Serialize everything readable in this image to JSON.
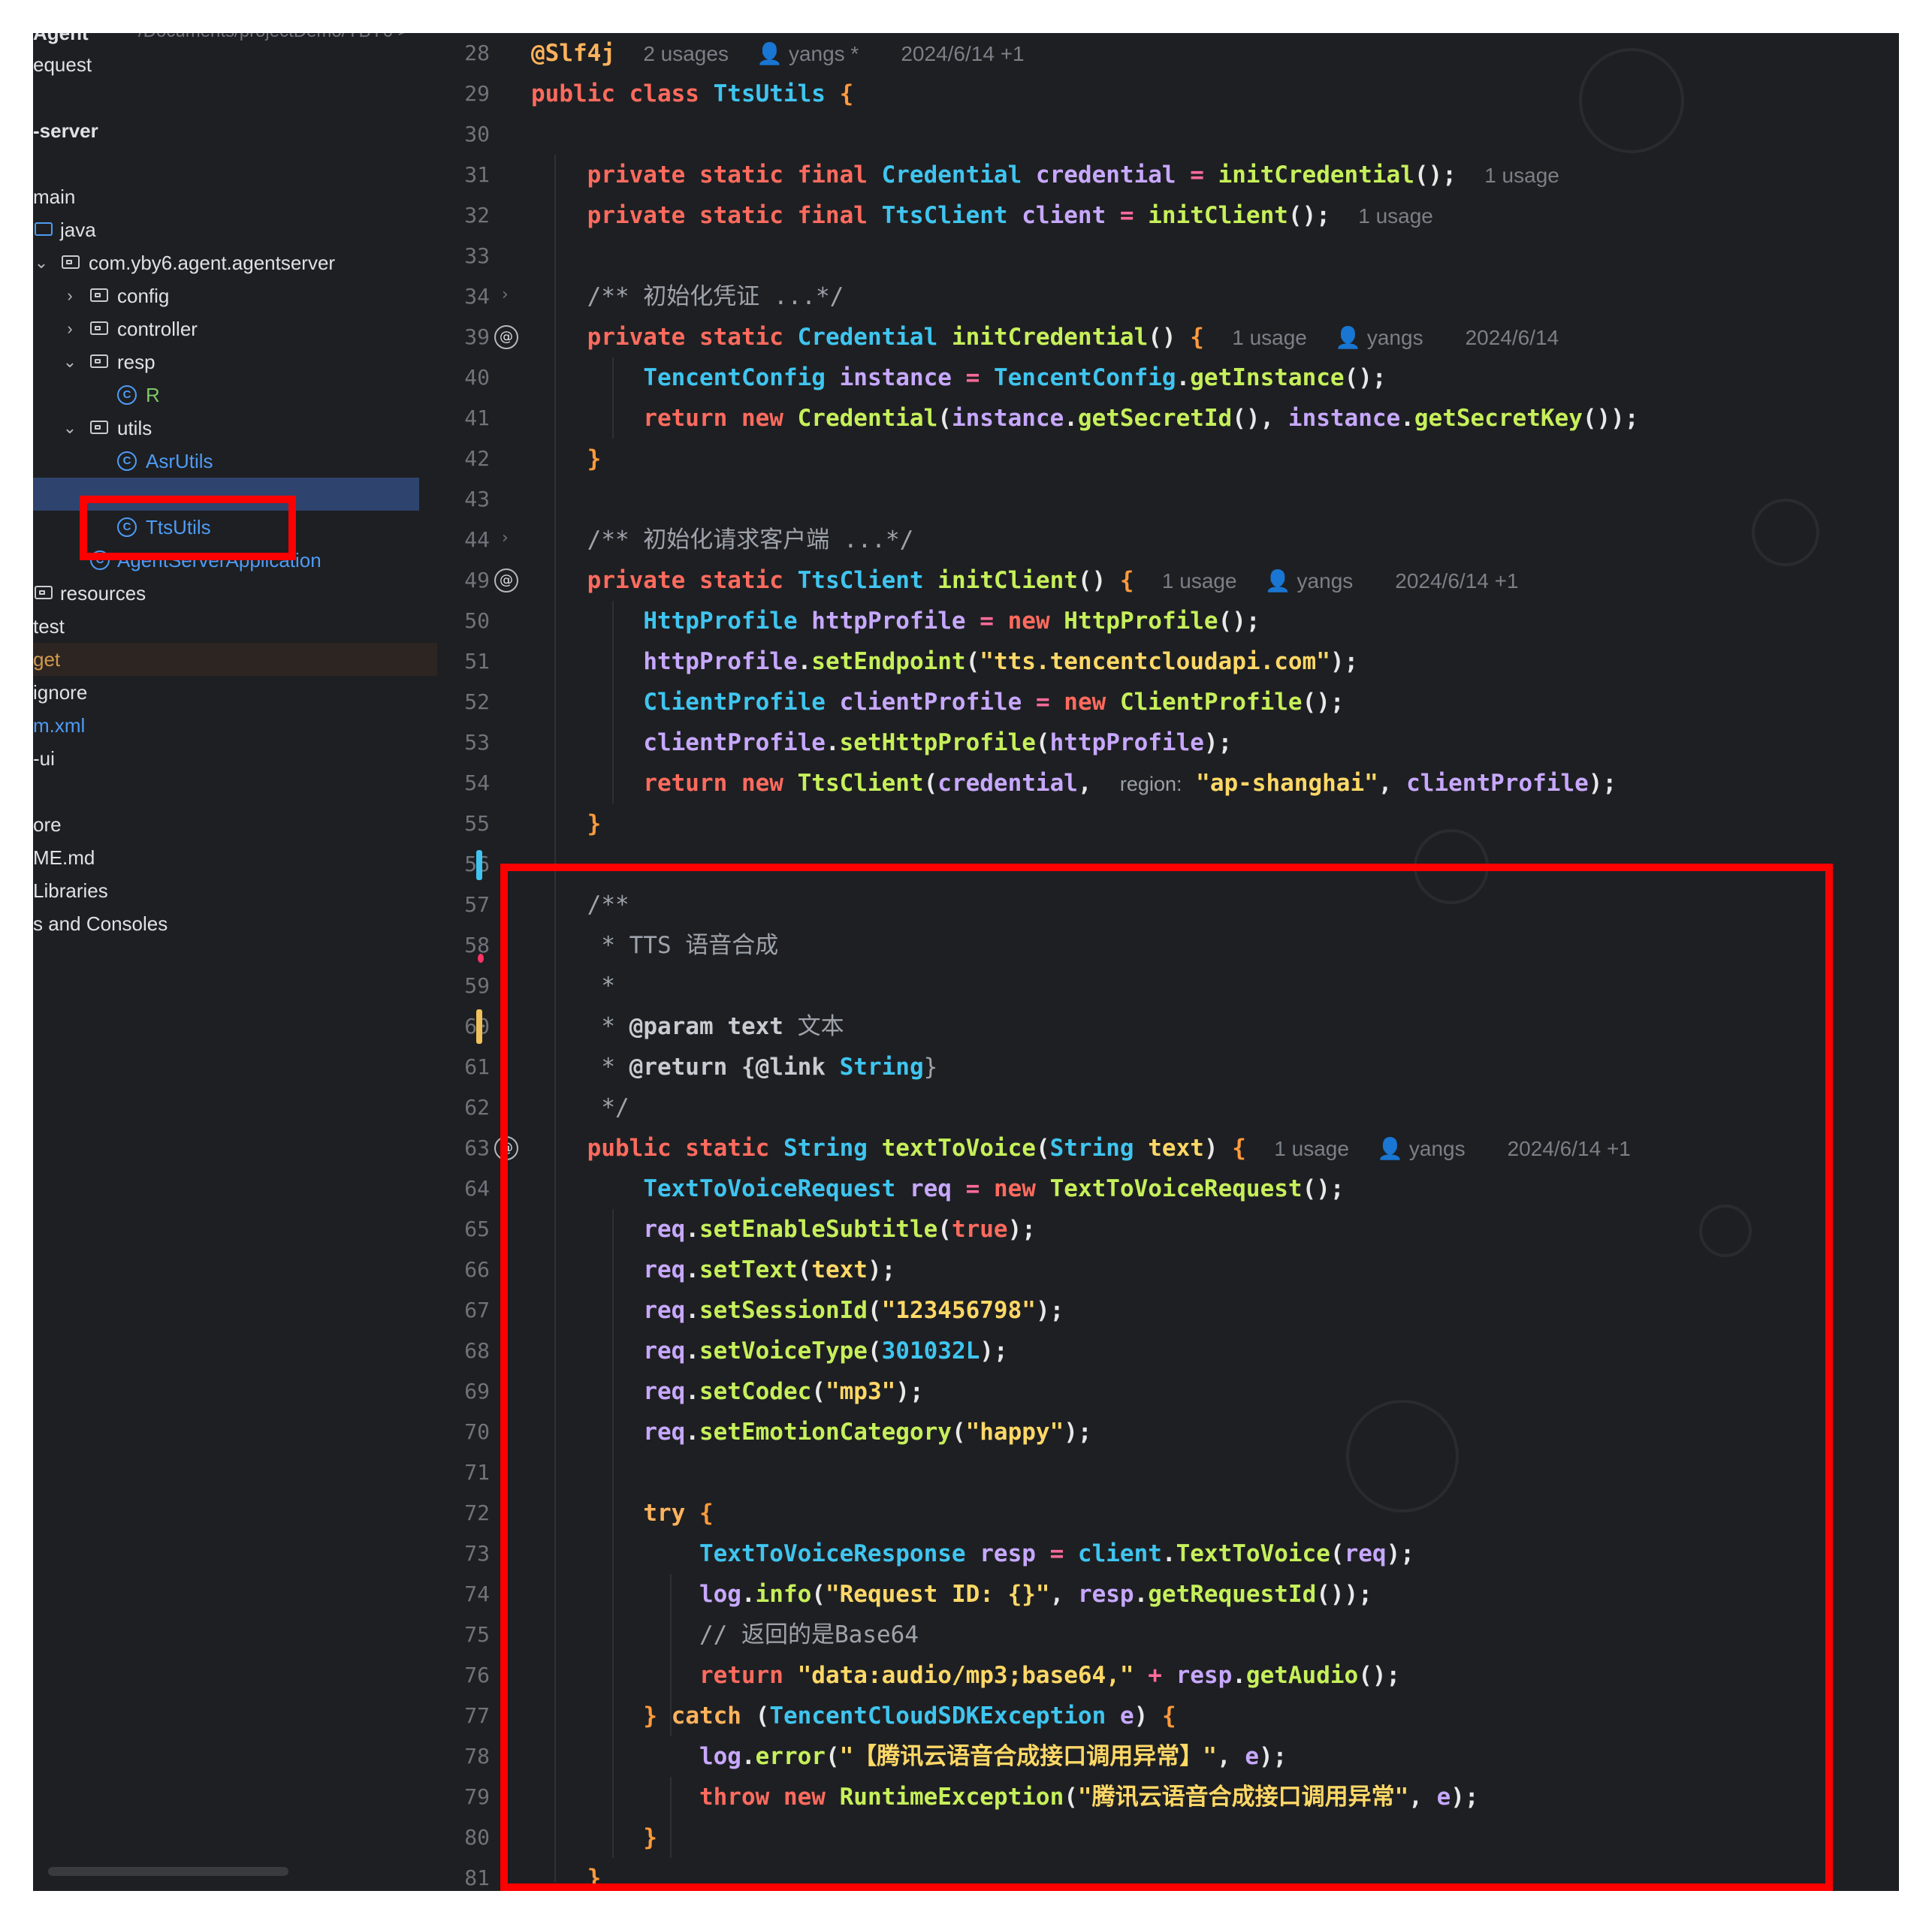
{
  "sidebar": {
    "path_fragment": "/Documents/projectDemo/YBY6 >",
    "items": [
      {
        "label": "Agent",
        "type": "module"
      },
      {
        "label": "equest",
        "type": "module"
      },
      {
        "label": "-server",
        "type": "module"
      },
      {
        "label": "main",
        "type": "folder"
      },
      {
        "label": "java",
        "type": "source-folder"
      },
      {
        "label": "com.yby6.agent.agentserver",
        "type": "package"
      },
      {
        "label": "config",
        "type": "package"
      },
      {
        "label": "controller",
        "type": "package"
      },
      {
        "label": "resp",
        "type": "package"
      },
      {
        "label": "R",
        "type": "class"
      },
      {
        "label": "utils",
        "type": "package"
      },
      {
        "label": "AsrUtils",
        "type": "class"
      },
      {
        "label": "TtsUtils",
        "type": "class"
      },
      {
        "label": "AgentServerApplication",
        "type": "class"
      },
      {
        "label": "resources",
        "type": "resource-folder"
      },
      {
        "label": "test",
        "type": "folder"
      },
      {
        "label": "get",
        "type": "folder"
      },
      {
        "label": "ignore",
        "type": "file"
      },
      {
        "label": "m.xml",
        "type": "file"
      },
      {
        "label": "-ui",
        "type": "module"
      },
      {
        "label": "ore",
        "type": "file"
      },
      {
        "label": "ME.md",
        "type": "file"
      },
      {
        "label": "Libraries",
        "type": "group"
      },
      {
        "label": "s and Consoles",
        "type": "group"
      }
    ]
  },
  "editor": {
    "hints": {
      "usages2": "2 usages",
      "usage1": "1 usage",
      "author_star": "yangs *",
      "author": "yangs",
      "date_plus": "2024/6/14 +1",
      "date": "2024/6/14",
      "region": "region:"
    },
    "line_numbers": [
      "28",
      "29",
      "30",
      "31",
      "32",
      "33",
      "34",
      "39",
      "40",
      "41",
      "42",
      "43",
      "44",
      "49",
      "50",
      "51",
      "52",
      "53",
      "54",
      "55",
      "56",
      "57",
      "58",
      "59",
      "60",
      "61",
      "62",
      "63",
      "64",
      "65",
      "66",
      "67",
      "68",
      "69",
      "70",
      "71",
      "72",
      "73",
      "74",
      "75",
      "76",
      "77",
      "78",
      "79",
      "80",
      "81"
    ],
    "code": {
      "l28_annot": "@Slf4j",
      "l29_kw": "public class",
      "l29_cls": "TtsUtils",
      "l31_kw": "private static final",
      "l31_type": "Credential",
      "l31_var": "credential",
      "l31_call": "initCredential",
      "l32_type": "TtsClient",
      "l32_var": "client",
      "l32_call": "initClient",
      "l34_comment": "/** 初始化凭证 ...*/",
      "l39_kw": "private static",
      "l39_type": "Credential",
      "l39_method": "initCredential",
      "l40_type": "TencentConfig",
      "l40_var": "instance",
      "l40_type2": "TencentConfig",
      "l40_call": "getInstance",
      "l41_kw": "return new",
      "l41_type": "Credential",
      "l41_v1": "instance",
      "l41_m1": "getSecretId",
      "l41_v2": "instance",
      "l41_m2": "getSecretKey",
      "l44_comment": "/** 初始化请求客户端 ...*/",
      "l49_type": "TtsClient",
      "l49_method": "initClient",
      "l50_type": "HttpProfile",
      "l50_var": "httpProfile",
      "l50_new": "new",
      "l51_var": "httpProfile",
      "l51_m": "setEndpoint",
      "l51_str": "\"tts.tencentcloudapi.com\"",
      "l52_type": "ClientProfile",
      "l52_var": "clientProfile",
      "l53_var": "clientProfile",
      "l53_m": "setHttpProfile",
      "l53_arg": "httpProfile",
      "l54_type": "TtsClient",
      "l54_arg1": "credential",
      "l54_str": "\"ap-shanghai\"",
      "l54_arg2": "clientProfile",
      "l57": "/**",
      "l58": " * TTS 语音合成",
      "l59": " *",
      "l60_star": " * ",
      "l60_tag": "@param",
      "l60_name": "text",
      "l60_desc": "文本",
      "l61_tag": "@return",
      "l61_link": "{@link",
      "l61_type": "String",
      "l61_close": "}",
      "l62": " */",
      "l63_kw": "public static",
      "l63_type": "String",
      "l63_method": "textToVoice",
      "l63_ptype": "String",
      "l63_pname": "text",
      "l64_type": "TextToVoiceRequest",
      "l64_var": "req",
      "l64_type2": "TextToVoiceRequest",
      "req": "req",
      "l65_m": "setEnableSubtitle",
      "l65_arg": "true",
      "l66_m": "setText",
      "l66_arg": "text",
      "l67_m": "setSessionId",
      "l67_arg": "\"123456798\"",
      "l68_m": "setVoiceType",
      "l68_arg": "301032L",
      "l69_m": "setCodec",
      "l69_arg": "\"mp3\"",
      "l70_m": "setEmotionCategory",
      "l70_arg": "\"happy\"",
      "l72_kw": "try",
      "l73_type": "TextToVoiceResponse",
      "l73_var": "resp",
      "l73_obj": "client",
      "l73_m": "TextToVoice",
      "l73_arg": "req",
      "log": "log",
      "l74_m": "info",
      "l74_str": "\"Request ID: {}\"",
      "l74_obj": "resp",
      "l74_m2": "getRequestId",
      "l75_comment": "// 返回的是Base64",
      "l76_kw": "return",
      "l76_str": "\"data:audio/mp3;base64,\"",
      "l76_obj": "resp",
      "l76_m": "getAudio",
      "l77_catch": "catch",
      "l77_type": "TencentCloudSDKException",
      "l77_var": "e",
      "l78_m": "error",
      "l78_str": "\"【腾讯云语音合成接口调用异常】\"",
      "l79_kw": "throw new",
      "l79_type": "RuntimeException",
      "l79_str": "\"腾讯云语音合成接口调用异常\"",
      "e": "e"
    }
  },
  "colors": {
    "highlight_box": "#ff0000",
    "selected_row": "#2e436e",
    "editor_bg": "#1e1f22"
  }
}
